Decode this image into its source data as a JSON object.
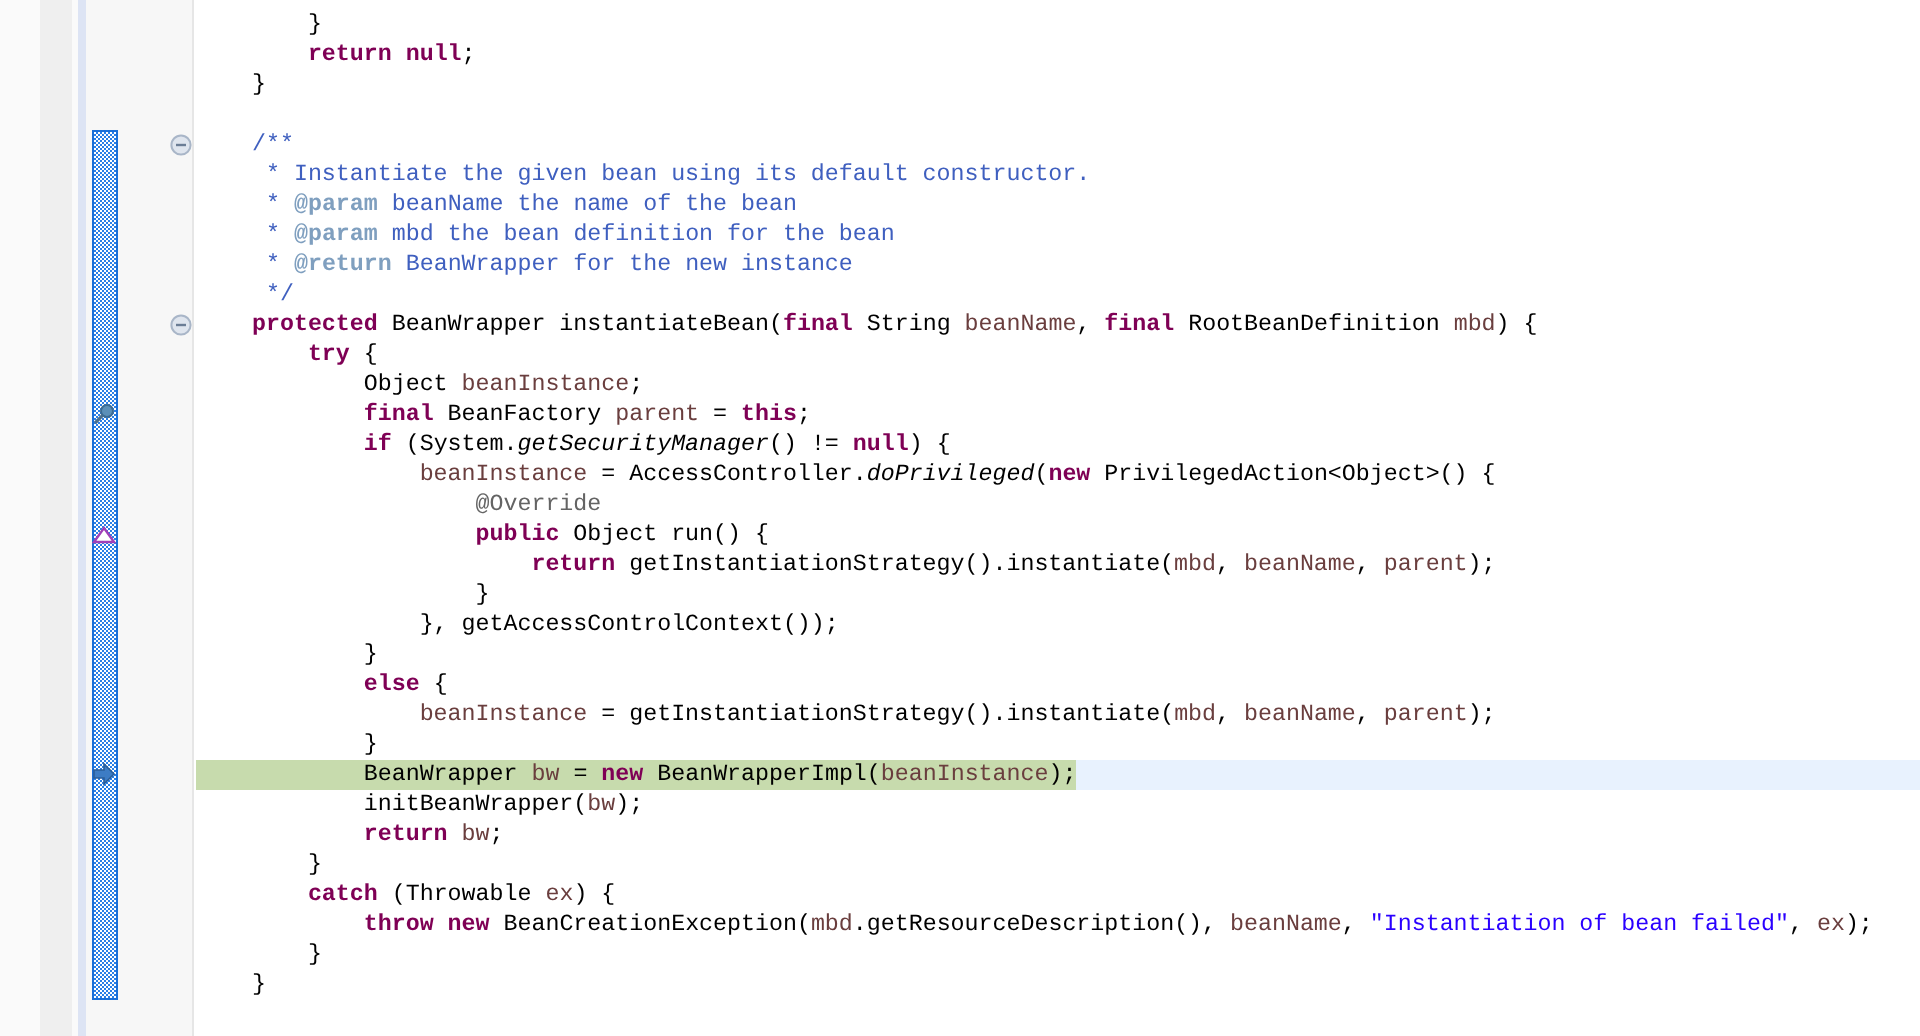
{
  "editor": {
    "lines": [
      {
        "tokens": [
          {
            "text": "    }",
            "kind": "plain"
          }
        ],
        "highlighted": false,
        "fold": false
      },
      {
        "tokens": [
          {
            "text": "    return",
            "kind": "keyword"
          },
          {
            "text": " null",
            "kind": "keyword"
          },
          {
            "text": ";",
            "kind": "plain"
          }
        ],
        "highlighted": false,
        "fold": false
      },
      {
        "tokens": [
          {
            "text": "}",
            "kind": "plain"
          }
        ],
        "highlighted": false,
        "fold": false
      },
      {
        "highlighted": false,
        "fold": false
      }
    ],
    "method": {
      "lines": [
        {
          "tokens": [
            {
              "text": "/**",
              "kind": "comment"
            }
          ],
          "highlighted": false,
          "fold": true
        },
        {
          "tokens": [
            {
              "text": " * Instantiate the given bean using its default constructor.",
              "kind": "comment"
            }
          ],
          "highlighted": false,
          "fold": false
        },
        {
          "tokens": [
            {
              "text": " * ",
              "kind": "comment"
            },
            {
              "text": "@param",
              "kind": "doctag"
            },
            {
              "text": " beanName the name of the bean",
              "kind": "comment"
            }
          ],
          "highlighted": false,
          "fold": false
        },
        {
          "tokens": [
            {
              "text": " * ",
              "kind": "comment"
            },
            {
              "text": "@param",
              "kind": "doctag"
            },
            {
              "text": " mbd the bean definition for the bean",
              "kind": "comment"
            }
          ],
          "highlighted": false,
          "fold": false
        },
        {
          "tokens": [
            {
              "text": " * ",
              "kind": "comment"
            },
            {
              "text": "@return",
              "kind": "doctag"
            },
            {
              "text": " BeanWrapper for the new instance",
              "kind": "comment"
            }
          ],
          "highlighted": false,
          "fold": false
        },
        {
          "tokens": [
            {
              "text": " */",
              "kind": "comment"
            }
          ],
          "highlighted": false,
          "fold": false
        },
        {
          "tokens": [
            {
              "text": "protected",
              "kind": "keyword"
            },
            {
              "text": " BeanWrapper instantiateBean(",
              "kind": "plain"
            },
            {
              "text": "final",
              "kind": "keyword"
            },
            {
              "text": " String ",
              "kind": "plain"
            },
            {
              "text": "beanName",
              "kind": "variable"
            },
            {
              "text": ", ",
              "kind": "plain"
            },
            {
              "text": "final",
              "kind": "keyword"
            },
            {
              "text": " RootBeanDefinition ",
              "kind": "plain"
            },
            {
              "text": "mbd",
              "kind": "variable"
            },
            {
              "text": ") {",
              "kind": "plain"
            }
          ],
          "highlighted": false,
          "fold": true
        },
        {
          "tokens": [
            {
              "text": "    try",
              "kind": "keyword"
            },
            {
              "text": " {",
              "kind": "plain"
            }
          ],
          "highlighted": false,
          "fold": false
        },
        {
          "tokens": [
            {
              "text": "        Object ",
              "kind": "plain"
            },
            {
              "text": "beanInstance",
              "kind": "variable"
            },
            {
              "text": ";",
              "kind": "plain"
            }
          ],
          "highlighted": false,
          "fold": false
        },
        {
          "tokens": [
            {
              "text": "        final",
              "kind": "keyword"
            },
            {
              "text": " BeanFactory ",
              "kind": "plain"
            },
            {
              "text": "parent",
              "kind": "variable"
            },
            {
              "text": " = ",
              "kind": "plain"
            },
            {
              "text": "this",
              "kind": "keyword"
            },
            {
              "text": ";",
              "kind": "plain"
            }
          ],
          "highlighted": false,
          "fold": false,
          "marker": {
            "kind": "search"
          }
        },
        {
          "tokens": [
            {
              "text": "        if",
              "kind": "keyword"
            },
            {
              "text": " (System.",
              "kind": "plain"
            },
            {
              "text": "getSecurityManager",
              "kind": "static"
            },
            {
              "text": "() != ",
              "kind": "plain"
            },
            {
              "text": "null",
              "kind": "keyword"
            },
            {
              "text": ") {",
              "kind": "plain"
            }
          ],
          "highlighted": false,
          "fold": false
        },
        {
          "tokens": [
            {
              "text": "            beanInstance",
              "kind": "variable"
            },
            {
              "text": " = AccessController.",
              "kind": "plain"
            },
            {
              "text": "doPrivileged",
              "kind": "static"
            },
            {
              "text": "(",
              "kind": "plain"
            },
            {
              "text": "new",
              "kind": "keyword"
            },
            {
              "text": " PrivilegedAction<Object>() {",
              "kind": "plain"
            }
          ],
          "highlighted": false,
          "fold": false
        },
        {
          "tokens": [
            {
              "text": "                @Override",
              "kind": "annotation"
            }
          ],
          "highlighted": false,
          "fold": false
        },
        {
          "tokens": [
            {
              "text": "                public",
              "kind": "keyword"
            },
            {
              "text": " Object run() {",
              "kind": "plain"
            }
          ],
          "highlighted": false,
          "fold": false,
          "marker": {
            "kind": "triangle"
          }
        },
        {
          "tokens": [
            {
              "text": "                    return",
              "kind": "keyword"
            },
            {
              "text": " getInstantiationStrategy().instantiate(",
              "kind": "plain"
            },
            {
              "text": "mbd",
              "kind": "variable"
            },
            {
              "text": ", ",
              "kind": "plain"
            },
            {
              "text": "beanName",
              "kind": "variable"
            },
            {
              "text": ", ",
              "kind": "plain"
            },
            {
              "text": "parent",
              "kind": "variable"
            },
            {
              "text": ");",
              "kind": "plain"
            }
          ],
          "highlighted": false,
          "fold": false
        },
        {
          "tokens": [
            {
              "text": "                }",
              "kind": "plain"
            }
          ],
          "highlighted": false,
          "fold": false
        },
        {
          "tokens": [
            {
              "text": "            }, getAccessControlContext());",
              "kind": "plain"
            }
          ],
          "highlighted": false,
          "fold": false
        },
        {
          "tokens": [
            {
              "text": "        }",
              "kind": "plain"
            }
          ],
          "highlighted": false,
          "fold": false
        },
        {
          "tokens": [
            {
              "text": "        else",
              "kind": "keyword"
            },
            {
              "text": " {",
              "kind": "plain"
            }
          ],
          "highlighted": false,
          "fold": false
        },
        {
          "tokens": [
            {
              "text": "            beanInstance",
              "kind": "variable"
            },
            {
              "text": " = getInstantiationStrategy().instantiate(",
              "kind": "plain"
            },
            {
              "text": "mbd",
              "kind": "variable"
            },
            {
              "text": ", ",
              "kind": "plain"
            },
            {
              "text": "beanName",
              "kind": "variable"
            },
            {
              "text": ", ",
              "kind": "plain"
            },
            {
              "text": "parent",
              "kind": "variable"
            },
            {
              "text": ");",
              "kind": "plain"
            }
          ],
          "highlighted": false,
          "fold": false
        },
        {
          "tokens": [
            {
              "text": "        }",
              "kind": "plain"
            }
          ],
          "highlighted": false,
          "fold": false
        },
        {
          "tokens": [
            {
              "text": "        BeanWrapper ",
              "kind": "plain"
            },
            {
              "text": "bw",
              "kind": "variable"
            },
            {
              "text": " = ",
              "kind": "plain"
            },
            {
              "text": "new",
              "kind": "keyword"
            },
            {
              "text": " BeanWrapperImpl(",
              "kind": "plain"
            },
            {
              "text": "beanInstance",
              "kind": "variable"
            },
            {
              "text": ");",
              "kind": "plain"
            }
          ],
          "highlighted": true,
          "fold": false,
          "marker": {
            "kind": "arrow"
          }
        },
        {
          "tokens": [
            {
              "text": "        initBeanWrapper(",
              "kind": "plain"
            },
            {
              "text": "bw",
              "kind": "variable"
            },
            {
              "text": ");",
              "kind": "plain"
            }
          ],
          "highlighted": false,
          "fold": false
        },
        {
          "tokens": [
            {
              "text": "        return",
              "kind": "keyword"
            },
            {
              "text": " bw",
              "kind": "variable"
            },
            {
              "text": ";",
              "kind": "plain"
            }
          ],
          "highlighted": false,
          "fold": false
        },
        {
          "tokens": [
            {
              "text": "    }",
              "kind": "plain"
            }
          ],
          "highlighted": false,
          "fold": false
        },
        {
          "tokens": [
            {
              "text": "    catch",
              "kind": "keyword"
            },
            {
              "text": " (Throwable ",
              "kind": "plain"
            },
            {
              "text": "ex",
              "kind": "variable"
            },
            {
              "text": ") {",
              "kind": "plain"
            }
          ],
          "highlighted": false,
          "fold": false
        },
        {
          "tokens": [
            {
              "text": "        throw",
              "kind": "keyword"
            },
            {
              "text": " new",
              "kind": "keyword"
            },
            {
              "text": " BeanCreationException(",
              "kind": "plain"
            },
            {
              "text": "mbd",
              "kind": "variable"
            },
            {
              "text": ".getResourceDescription(), ",
              "kind": "plain"
            },
            {
              "text": "beanName",
              "kind": "variable"
            },
            {
              "text": ", ",
              "kind": "plain"
            },
            {
              "text": "\"Instantiation of bean failed\"",
              "kind": "string"
            },
            {
              "text": ", ",
              "kind": "plain"
            },
            {
              "text": "ex",
              "kind": "variable"
            },
            {
              "text": ");",
              "kind": "plain"
            }
          ],
          "highlighted": false,
          "fold": false
        },
        {
          "tokens": [
            {
              "text": "    }",
              "kind": "plain"
            }
          ],
          "highlighted": false,
          "fold": false
        },
        {
          "tokens": [
            {
              "text": "}",
              "kind": "plain"
            }
          ],
          "highlighted": false,
          "fold": false
        }
      ]
    }
  }
}
